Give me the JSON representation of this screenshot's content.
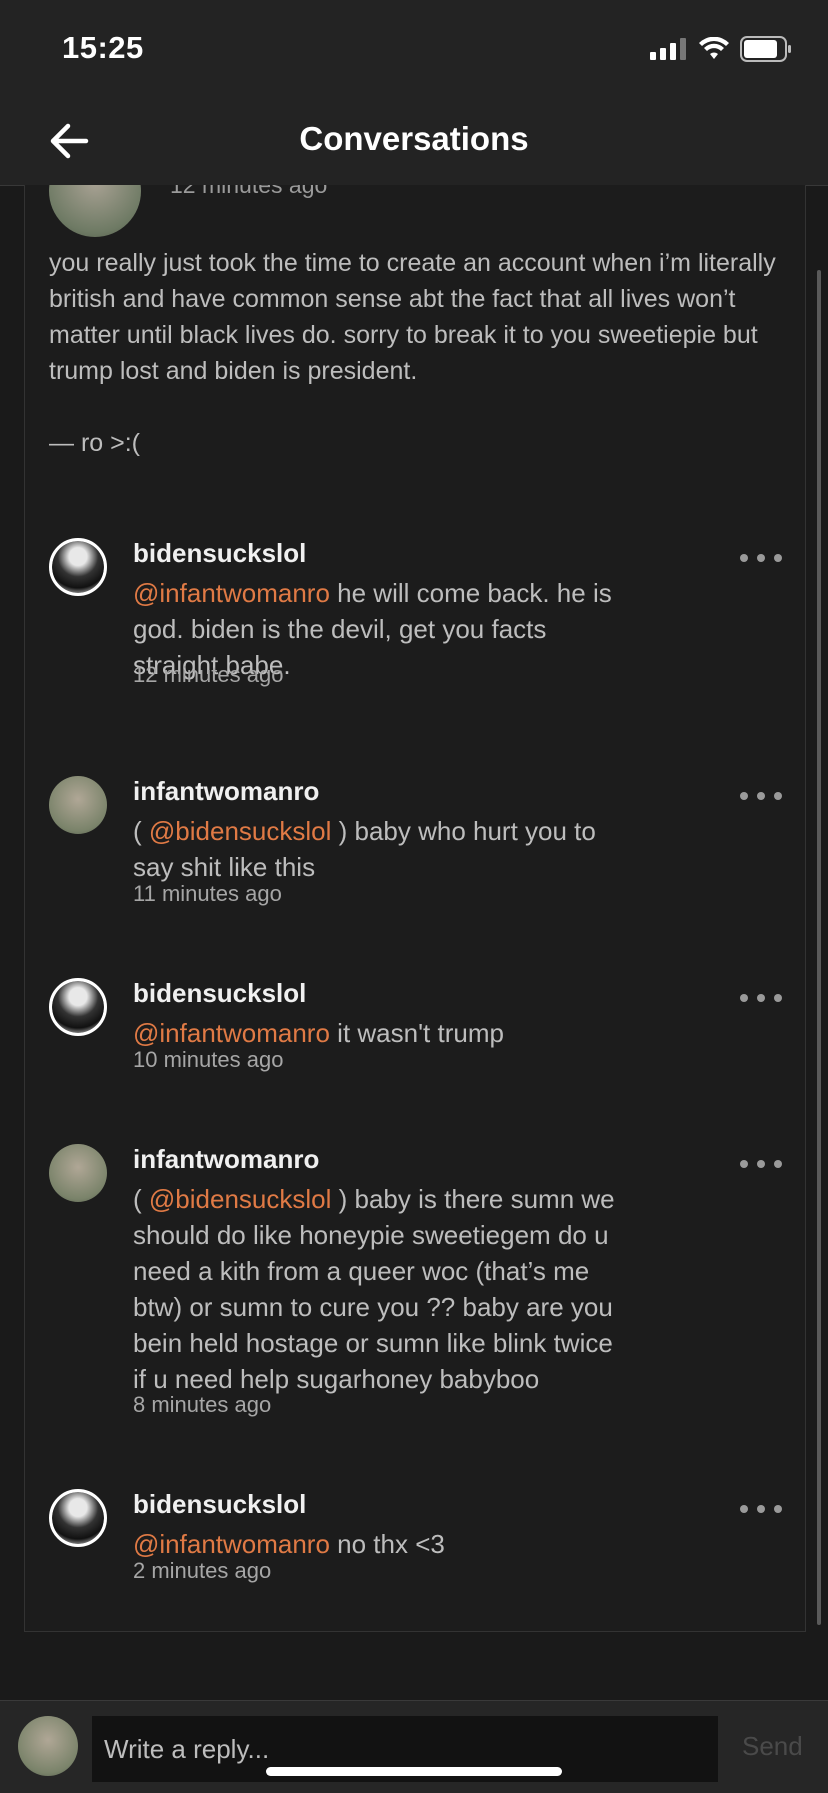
{
  "status": {
    "time": "15:25",
    "icons": [
      "signal-icon",
      "wifi-icon",
      "battery-icon"
    ]
  },
  "nav": {
    "title": "Conversations",
    "back_icon": "arrow-left-icon"
  },
  "op": {
    "time": "12 minutes ago",
    "text": "you really just took the time to create an account when i’m literally british and have common sense abt the fact that all lives won’t matter until black lives do. sorry to break it to you sweetiepie but trump lost and biden is president.",
    "signature": "— ro >:("
  },
  "comments": [
    {
      "user": "bidensuckslol",
      "mention": "@infantwomanro",
      "prefix": "",
      "suffix_bracket": "",
      "text": " he will come back. he is god. biden is the devil, get you facts straight babe.",
      "time": "12 minutes ago"
    },
    {
      "user": "infantwomanro",
      "mention": "@bidensuckslol",
      "prefix": "( ",
      "suffix_bracket": " )",
      "text": " baby who hurt you to say shit like this",
      "time": "11 minutes ago"
    },
    {
      "user": "bidensuckslol",
      "mention": "@infantwomanro",
      "prefix": "",
      "suffix_bracket": "",
      "text": " it wasn't trump",
      "time": "10 minutes ago"
    },
    {
      "user": "infantwomanro",
      "mention": "@bidensuckslol",
      "prefix": "( ",
      "suffix_bracket": " )",
      "text": " baby is there sumn we should do like honeypie sweetiegem do u need a kith from a queer woc (that’s me btw) or sumn to cure you ?? baby are you bein held hostage or sumn like blink twice if u need help sugarhoney babyboo",
      "time": "8 minutes ago"
    },
    {
      "user": "bidensuckslol",
      "mention": "@infantwomanro",
      "prefix": "",
      "suffix_bracket": "",
      "text": " no thx <3",
      "time": "2 minutes ago"
    }
  ],
  "reply": {
    "placeholder": "Write a reply...",
    "send_label": "Send"
  },
  "colors": {
    "mention": "#e07a45",
    "background": "#1a1a1a",
    "bar": "#232323"
  }
}
